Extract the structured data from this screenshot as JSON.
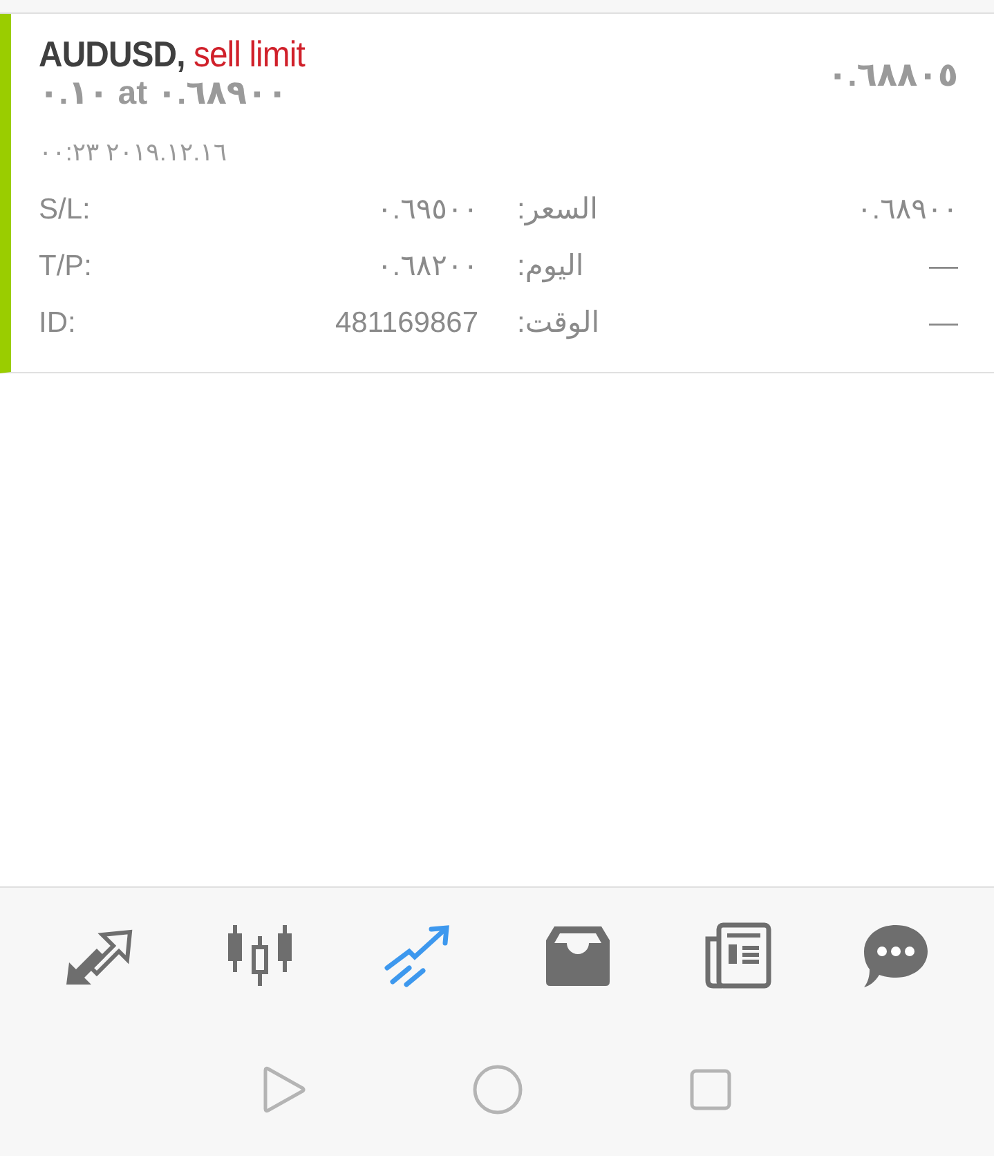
{
  "order": {
    "symbol": "AUDUSD,",
    "type": "sell limit",
    "volume_line": "٠.١٠ at ٠.٦٨٩٠٠",
    "current_price": "٠.٦٨٨٠٥",
    "time": "٠٠:٢٣ ٢٠١٩.١٢.١٦",
    "details": [
      {
        "label": "S/L:",
        "value": "٠.٦٩٥٠٠",
        "label_2": "السعر:",
        "value_2": "٠.٦٨٩٠٠"
      },
      {
        "label": "T/P:",
        "value": "٠.٦٨٢٠٠",
        "label_2": "اليوم:",
        "value_2": "—"
      },
      {
        "label": "ID:",
        "value": "481169867",
        "label_2": "الوقت:",
        "value_2": "—"
      }
    ]
  },
  "tabs": [
    {
      "selected": false
    },
    {
      "selected": false
    },
    {
      "selected": true
    },
    {
      "selected": false
    },
    {
      "selected": false
    },
    {
      "selected": false
    }
  ]
}
